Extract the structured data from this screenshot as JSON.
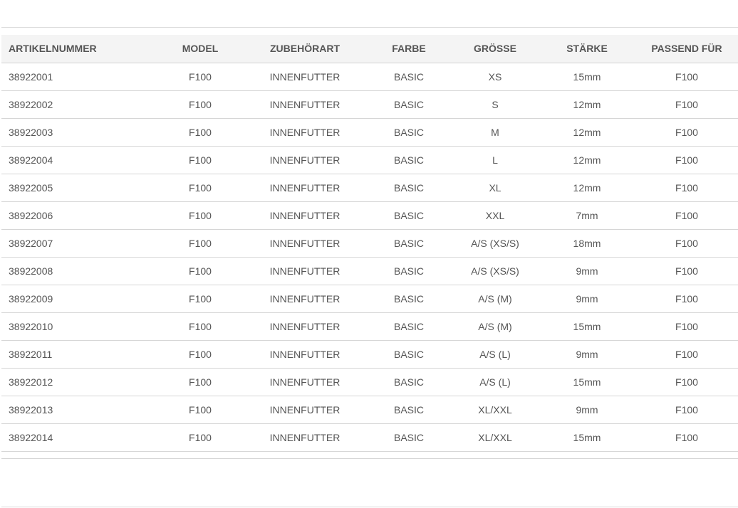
{
  "table": {
    "headers": [
      "ARTIKELNUMMER",
      "MODEL",
      "ZUBEHÖRART",
      "FARBE",
      "GRÖSSE",
      "STÄRKE",
      "PASSEND FÜR"
    ],
    "rows": [
      [
        "38922001",
        "F100",
        "INNENFUTTER",
        "BASIC",
        "XS",
        "15mm",
        "F100"
      ],
      [
        "38922002",
        "F100",
        "INNENFUTTER",
        "BASIC",
        "S",
        "12mm",
        "F100"
      ],
      [
        "38922003",
        "F100",
        "INNENFUTTER",
        "BASIC",
        "M",
        "12mm",
        "F100"
      ],
      [
        "38922004",
        "F100",
        "INNENFUTTER",
        "BASIC",
        "L",
        "12mm",
        "F100"
      ],
      [
        "38922005",
        "F100",
        "INNENFUTTER",
        "BASIC",
        "XL",
        "12mm",
        "F100"
      ],
      [
        "38922006",
        "F100",
        "INNENFUTTER",
        "BASIC",
        "XXL",
        "7mm",
        "F100"
      ],
      [
        "38922007",
        "F100",
        "INNENFUTTER",
        "BASIC",
        "A/S (XS/S)",
        "18mm",
        "F100"
      ],
      [
        "38922008",
        "F100",
        "INNENFUTTER",
        "BASIC",
        "A/S (XS/S)",
        "9mm",
        "F100"
      ],
      [
        "38922009",
        "F100",
        "INNENFUTTER",
        "BASIC",
        "A/S (M)",
        "9mm",
        "F100"
      ],
      [
        "38922010",
        "F100",
        "INNENFUTTER",
        "BASIC",
        "A/S (M)",
        "15mm",
        "F100"
      ],
      [
        "38922011",
        "F100",
        "INNENFUTTER",
        "BASIC",
        "A/S (L)",
        "9mm",
        "F100"
      ],
      [
        "38922012",
        "F100",
        "INNENFUTTER",
        "BASIC",
        "A/S (L)",
        "15mm",
        "F100"
      ],
      [
        "38922013",
        "F100",
        "INNENFUTTER",
        "BASIC",
        "XL/XXL",
        "9mm",
        "F100"
      ],
      [
        "38922014",
        "F100",
        "INNENFUTTER",
        "BASIC",
        "XL/XXL",
        "15mm",
        "F100"
      ]
    ]
  },
  "colors": {
    "text": "#555555",
    "header_bg": "#f4f4f4",
    "rule": "#d6d6d6"
  }
}
